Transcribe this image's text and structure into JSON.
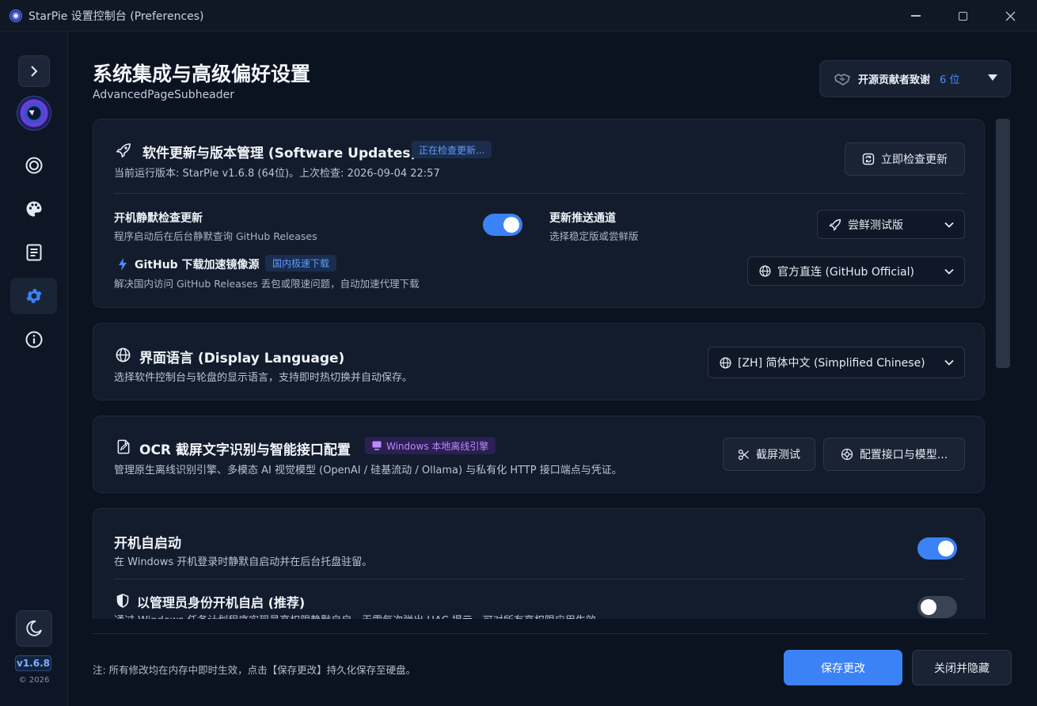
{
  "window": {
    "title": "StarPie 设置控制台 (Preferences)"
  },
  "sidebar": {
    "version": "v1.6.8",
    "copyright": "© 2026",
    "items": [
      {
        "icon": "target-icon"
      },
      {
        "icon": "palette-icon"
      },
      {
        "icon": "document-icon"
      },
      {
        "icon": "gear-icon",
        "active": true
      },
      {
        "icon": "info-icon"
      }
    ]
  },
  "header": {
    "title": "系统集成与高级偏好设置",
    "subtitle": "AdvancedPageSubheader",
    "contributors_label": "开源贡献者致谢",
    "contributors_count": "6 位"
  },
  "updates": {
    "title": "软件更新与版本管理 (Software Updates)",
    "status_tag": "正在检查更新...",
    "desc": "当前运行版本: StarPie v1.6.8 (64位)。上次检查: 2026-09-04 22:57",
    "check_button": "立即检查更新",
    "silent_check": {
      "title": "开机静默检查更新",
      "desc": "程序启动后在后台静默查询 GitHub Releases",
      "enabled": true
    },
    "channel": {
      "title": "更新推送通道",
      "desc": "选择稳定版或尝鲜版",
      "value": "尝鲜测试版"
    },
    "mirror": {
      "title": "GitHub 下载加速镜像源",
      "tag": "国内极速下载",
      "desc": "解决国内访问 GitHub Releases 丢包或限速问题，自动加速代理下载",
      "value": "官方直连 (GitHub Official)"
    }
  },
  "language": {
    "title": "界面语言 (Display Language)",
    "desc": "选择软件控制台与轮盘的显示语言，支持即时热切换并自动保存。",
    "value": "[ZH] 简体中文 (Simplified Chinese)"
  },
  "ocr": {
    "title": "OCR 截屏文字识别与智能接口配置",
    "tag": "Windows 本地离线引擎",
    "desc": "管理原生离线识别引擎、多模态 AI 视觉模型 (OpenAI / 硅基流动 / Ollama) 与私有化 HTTP 接口端点与凭证。",
    "test_button": "截屏测试",
    "config_button": "配置接口与模型..."
  },
  "startup": {
    "title": "开机自启动",
    "desc": "在 Windows 开机登录时静默自启动并在后台托盘驻留。",
    "enabled": true,
    "admin": {
      "title": "以管理员身份开机自启 (推荐)",
      "desc": "通过 Windows 任务计划程序实现最高权限静默自启，无需每次弹出 UAC 提示，可对所有高权限应用生效。",
      "enabled": false
    }
  },
  "footer": {
    "note": "注: 所有修改均在内存中即时生效，点击【保存更改】持久化保存至硬盘。",
    "save_button": "保存更改",
    "close_button": "关闭并隐藏"
  },
  "colors": {
    "accent": "#3b82f6",
    "background": "#0b1220",
    "card": "#131c2c"
  }
}
